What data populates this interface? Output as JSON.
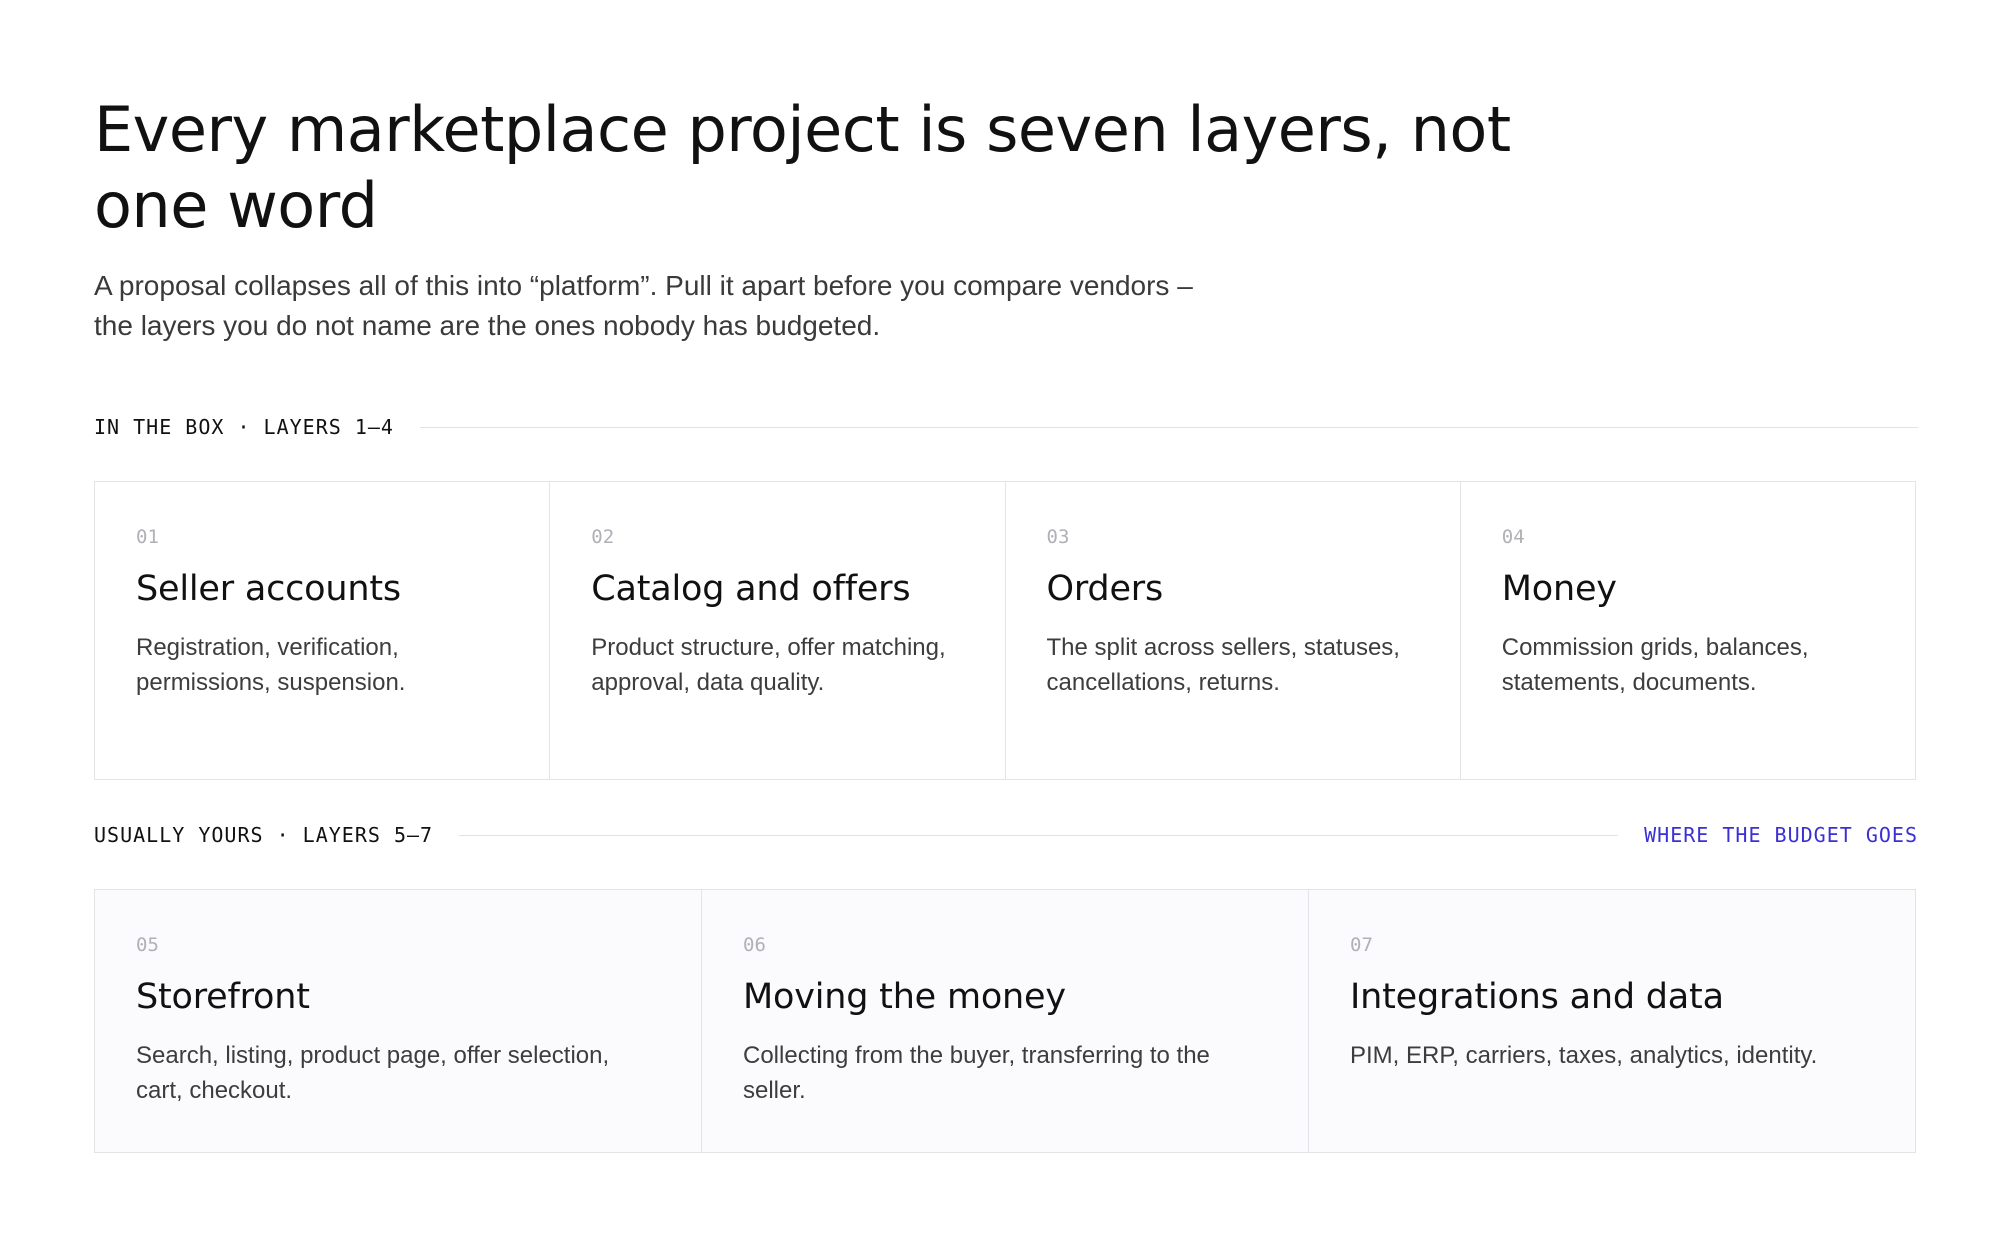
{
  "header": {
    "title": "Every marketplace project is seven layers, not one word",
    "lede": "A proposal collapses all of this into “platform”. Pull it apart before you compare vendors – the layers you do not name are the ones nobody has budgeted."
  },
  "sections": [
    {
      "label": "IN THE BOX · LAYERS 1–4",
      "aside": "",
      "cards": [
        {
          "num": "01",
          "title": "Seller accounts",
          "desc": "Registration, verification, permissions, suspension."
        },
        {
          "num": "02",
          "title": "Catalog and offers",
          "desc": "Product structure, offer matching, approval, data quality."
        },
        {
          "num": "03",
          "title": "Orders",
          "desc": "The split across sellers, statuses, cancellations, returns."
        },
        {
          "num": "04",
          "title": "Money",
          "desc": "Commission grids, balances, statements, documents."
        }
      ]
    },
    {
      "label": "USUALLY YOURS · LAYERS 5–7",
      "aside": "WHERE THE BUDGET GOES",
      "cards": [
        {
          "num": "05",
          "title": "Storefront",
          "desc": "Search, listing, product page, offer selection, cart, checkout."
        },
        {
          "num": "06",
          "title": "Moving the money",
          "desc": "Collecting from the buyer, transferring to the seller."
        },
        {
          "num": "07",
          "title": "Integrations and data",
          "desc": "PIM, ERP, carriers, taxes, analytics, identity."
        }
      ]
    }
  ],
  "colors": {
    "accent": "#3b2fd6",
    "text": "#111111",
    "muted": "#b0b0b6",
    "border": "#e3e3e8",
    "tinted_panel": "#fbfafd"
  }
}
